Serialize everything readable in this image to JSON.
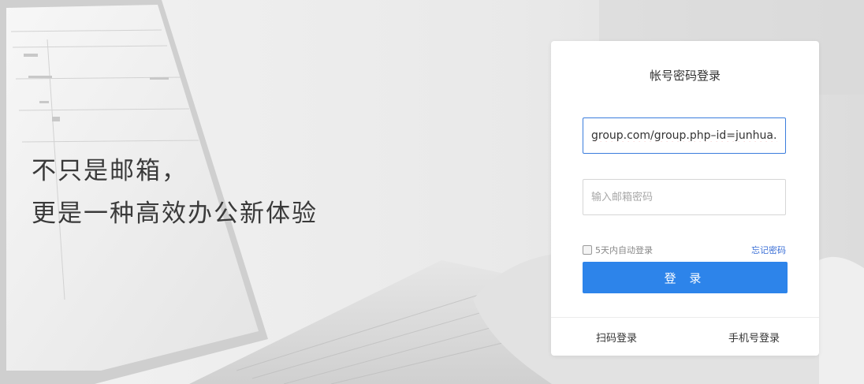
{
  "hero": {
    "line1": "不只是邮箱，",
    "line2": "更是一种高效办公新体验"
  },
  "login": {
    "title": "帐号密码登录",
    "account_value": "group.com/group.php–id=junhua.htm",
    "password_placeholder": "输入邮箱密码",
    "remember_label": "5天内自动登录",
    "forgot_label": "忘记密码",
    "submit_label": "登 录",
    "qr_login_label": "扫码登录",
    "phone_login_label": "手机号登录"
  },
  "colors": {
    "accent": "#2d84ea",
    "link": "#3b6fd6",
    "active_border": "#3b7ddd"
  }
}
